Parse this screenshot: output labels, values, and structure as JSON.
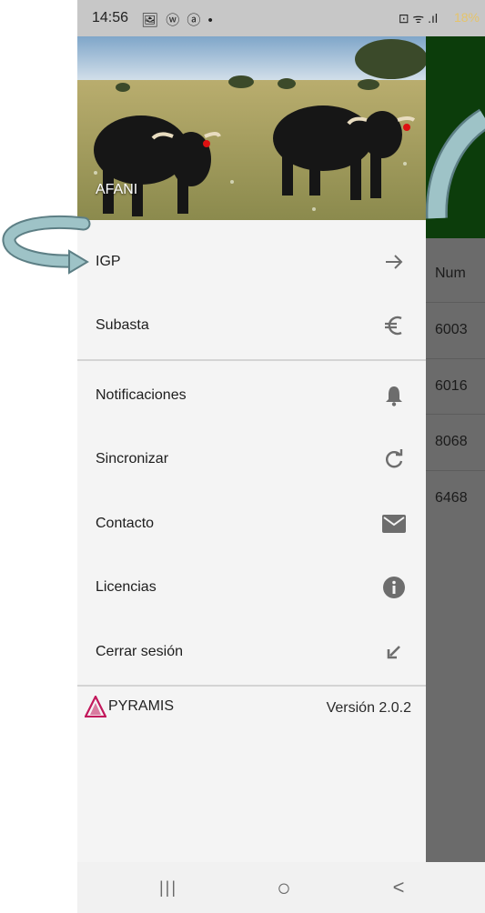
{
  "status_bar": {
    "time": "14:56",
    "notification_icons": "🖼 ⓦ ⓐ •",
    "right": "⊡ ᯤ .ıl",
    "battery": "18%"
  },
  "background_app": {
    "column_header": "Num",
    "rows": [
      "6003",
      "6016",
      "8068",
      "6468"
    ],
    "header_color": "#0c3d0b"
  },
  "drawer": {
    "header_label": "AFANI",
    "menu": [
      {
        "label": "IGP",
        "icon": "arrow-right-icon"
      },
      {
        "label": "Subasta",
        "icon": "euro-icon"
      },
      {
        "label": "Notificaciones",
        "icon": "bell-icon"
      },
      {
        "label": "Sincronizar",
        "icon": "refresh-icon"
      },
      {
        "label": "Contacto",
        "icon": "mail-icon"
      },
      {
        "label": "Licencias",
        "icon": "info-icon"
      },
      {
        "label": "Cerrar sesión",
        "icon": "arrow-down-left-icon"
      }
    ],
    "footer": {
      "logo_text": "PYRAMIS",
      "version": "Versión 2.0.2"
    }
  },
  "nav_bar": {
    "recents": "|||",
    "home": "○",
    "back": "<"
  },
  "colors": {
    "drawer_bg": "#f4f4f4",
    "dim_overlay": "#6b6b6b",
    "logo_accent": "#c2185b",
    "annotation_arrow": "#8fb3b8"
  }
}
